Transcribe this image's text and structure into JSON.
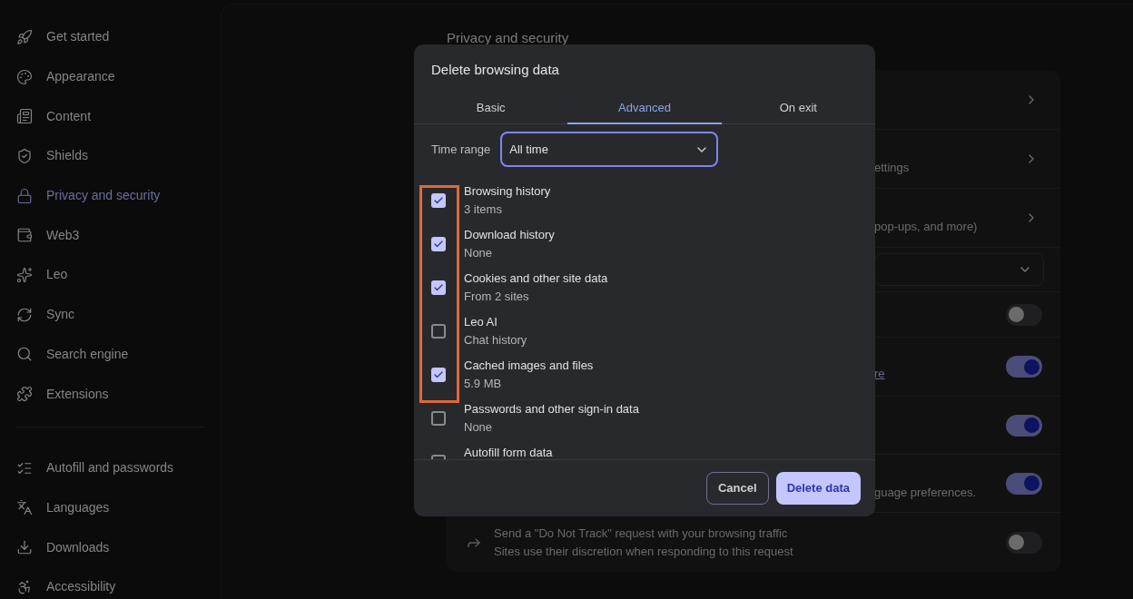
{
  "sidebar": {
    "groups": [
      {
        "items": [
          {
            "label": "Get started",
            "selected": false
          },
          {
            "label": "Appearance",
            "selected": false
          },
          {
            "label": "Content",
            "selected": false
          },
          {
            "label": "Shields",
            "selected": false
          },
          {
            "label": "Privacy and security",
            "selected": true
          },
          {
            "label": "Web3",
            "selected": false
          },
          {
            "label": "Leo",
            "selected": false
          },
          {
            "label": "Sync",
            "selected": false
          },
          {
            "label": "Search engine",
            "selected": false
          },
          {
            "label": "Extensions",
            "selected": false
          }
        ]
      },
      {
        "items": [
          {
            "label": "Autofill and passwords",
            "selected": false
          },
          {
            "label": "Languages",
            "selected": false
          },
          {
            "label": "Downloads",
            "selected": false
          },
          {
            "label": "Accessibility",
            "selected": false
          }
        ]
      }
    ]
  },
  "page": {
    "heading": "Privacy and security",
    "rows": [
      {
        "kind": "link"
      },
      {
        "kind": "link",
        "text": "ettings"
      },
      {
        "kind": "link",
        "text": "pop-ups, and more)"
      },
      {
        "kind": "select"
      },
      {
        "kind": "toggle",
        "on": false
      },
      {
        "kind": "toggle",
        "on": true,
        "link": "re"
      },
      {
        "kind": "toggle",
        "on": true
      },
      {
        "kind": "toggle",
        "on": true,
        "text": "guage preferences."
      },
      {
        "kind": "toggle",
        "on": false,
        "title": "Send a \"Do Not Track\" request with your browsing traffic",
        "text": "Sites use their discretion when responding to this request"
      }
    ]
  },
  "dialog": {
    "title": "Delete browsing data",
    "tabs": [
      {
        "label": "Basic",
        "selected": false
      },
      {
        "label": "Advanced",
        "selected": true
      },
      {
        "label": "On exit",
        "selected": false
      }
    ],
    "time_range": {
      "label": "Time range",
      "value": "All time"
    },
    "options": [
      {
        "label": "Browsing history",
        "detail": "3 items",
        "checked": true
      },
      {
        "label": "Download history",
        "detail": "None",
        "checked": true
      },
      {
        "label": "Cookies and other site data",
        "detail": "From 2 sites",
        "checked": true
      },
      {
        "label": "Leo AI",
        "detail": "Chat history",
        "checked": false
      },
      {
        "label": "Cached images and files",
        "detail": "5.9 MB",
        "checked": true
      },
      {
        "label": "Passwords and other sign-in data",
        "detail": "None",
        "checked": false
      },
      {
        "label": "Autofill form data",
        "checked": false
      }
    ],
    "buttons": [
      {
        "label": "Cancel",
        "kind": "secondary"
      },
      {
        "label": "Delete data",
        "kind": "primary"
      }
    ]
  }
}
